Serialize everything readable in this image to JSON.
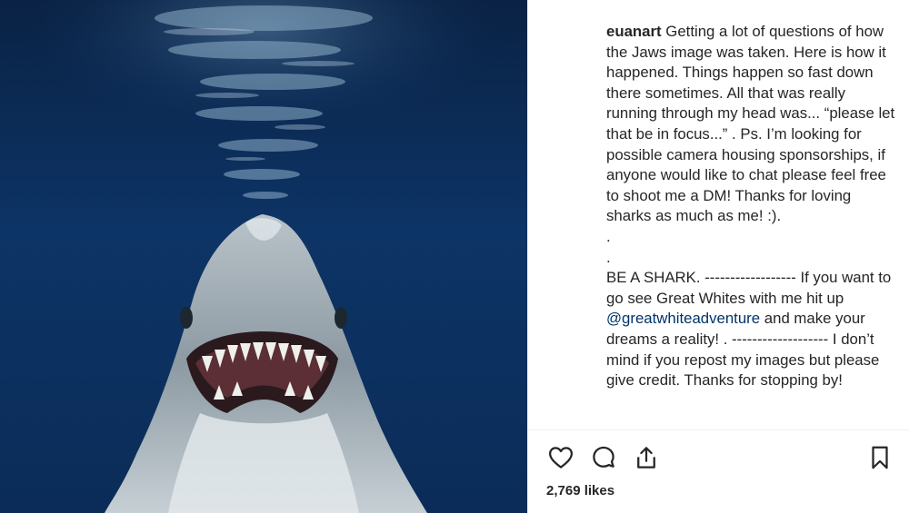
{
  "post": {
    "username": "euanart",
    "caption": {
      "intro": " Getting a lot of questions of how the Jaws image was taken. Here is how it happened. Things happen so fast down there sometimes. All that was really running through my head was... “please let that be in focus...” . Ps. I’m looking for possible camera housing sponsorships, if anyone would like to chat please feel free to shoot me a DM! Thanks for loving sharks as much as me! :).",
      "dot1": ".",
      "dot2": ".",
      "part_a": "BE A SHARK. ------------------ If you want to go see Great Whites with me hit up ",
      "mention": "@greatwhiteadventure",
      "part_b": " and make your dreams a reality! . ------------------- I don’t mind if you repost my images but please give credit. Thanks for stopping by!"
    },
    "likes": "2,769 likes"
  },
  "icons": {
    "like": "heart-icon",
    "comment": "comment-icon",
    "share": "share-icon",
    "save": "bookmark-icon"
  },
  "colors": {
    "text": "#262626",
    "mention": "#003569",
    "ocean": "#0b2a52"
  }
}
